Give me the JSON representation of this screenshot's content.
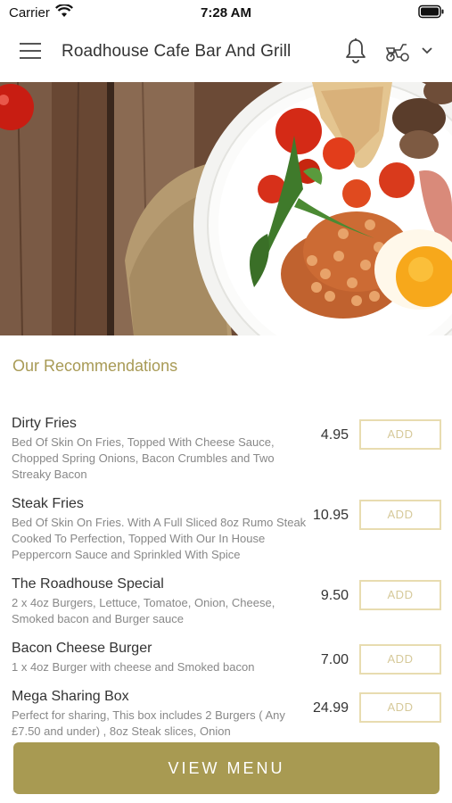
{
  "status_bar": {
    "carrier": "Carrier",
    "time": "7:28 AM"
  },
  "header": {
    "title": "Roadhouse Cafe Bar And Grill"
  },
  "recommendations": {
    "title": "Our Recommendations",
    "items": [
      {
        "name": "Dirty Fries",
        "description": "Bed Of Skin On Fries, Topped With Cheese Sauce, Chopped Spring Onions, Bacon Crumbles and Two Streaky Bacon",
        "price": "4.95",
        "button": "ADD"
      },
      {
        "name": "Steak Fries",
        "description": "Bed Of Skin On Fries. With A Full Sliced 8oz Rumo Steak Cooked To Perfection,  Topped With Our In House Peppercorn Sauce and Sprinkled With Spice",
        "price": "10.95",
        "button": "ADD"
      },
      {
        "name": "The Roadhouse Special",
        "description": "2 x 4oz Burgers, Lettuce, Tomatoe, Onion, Cheese, Smoked bacon and Burger sauce",
        "price": "9.50",
        "button": "ADD"
      },
      {
        "name": "Bacon Cheese Burger",
        "description": "1 x 4oz Burger with cheese and Smoked bacon",
        "price": "7.00",
        "button": "ADD"
      },
      {
        "name": "Mega Sharing Box",
        "description": "Perfect for sharing, This box includes 2 Burgers ( Any £7.50 and under) , 8oz Steak slices, Onion",
        "price": "24.99",
        "button": "ADD"
      }
    ]
  },
  "footer": {
    "view_menu_label": "VIEW MENU"
  },
  "colors": {
    "accent": "#a89a52",
    "button_border": "#e8dcb0"
  }
}
